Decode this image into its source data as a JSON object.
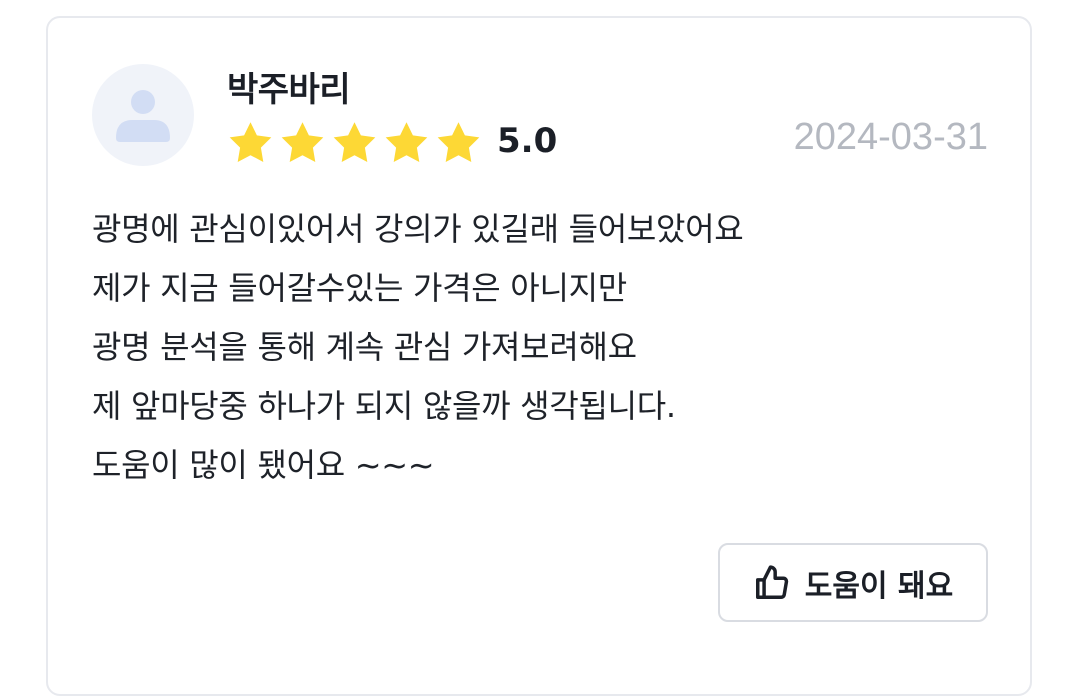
{
  "review": {
    "author": "박주바리",
    "rating": 5.0,
    "rating_text": "5.0",
    "stars_filled": 5,
    "stars_total": 5,
    "date": "2024-03-31",
    "lines": [
      "광명에 관심이있어서 강의가 있길래 들어보았어요",
      "제가 지금 들어갈수있는 가격은 아니지만",
      "광명 분석을 통해 계속 관심 가져보려해요",
      "제 앞마당중 하나가 되지 않을까 생각됩니다.",
      "도움이 많이 됐어요 ~~~"
    ],
    "helpful_label": "도움이 돼요"
  },
  "colors": {
    "star": "#fdd835",
    "avatar_bg": "#f0f3f9",
    "avatar_fg": "#d2ddf4",
    "date": "#b4b8c0",
    "card_border": "#e7e9ee"
  },
  "icons": {
    "avatar": "user-placeholder-icon",
    "star": "star-icon",
    "helpful": "thumbs-up-icon"
  }
}
